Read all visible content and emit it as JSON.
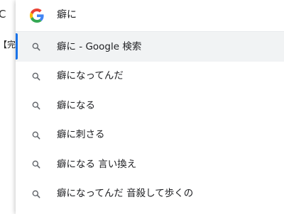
{
  "background_page": {
    "reload_glyph": "C",
    "text_fragment": "【完全"
  },
  "omnibox": {
    "engine_icon": "google-g-logo",
    "query": "癖に"
  },
  "suggestions": [
    {
      "label": "癖に - Google 検索",
      "icon": "search-icon",
      "selected": true
    },
    {
      "label": "癖になってんだ",
      "icon": "search-icon",
      "selected": false
    },
    {
      "label": "癖になる",
      "icon": "search-icon",
      "selected": false
    },
    {
      "label": "癖に刺さる",
      "icon": "search-icon",
      "selected": false
    },
    {
      "label": "癖になる 言い換え",
      "icon": "search-icon",
      "selected": false
    },
    {
      "label": "癖になってんだ 音殺して歩くの",
      "icon": "search-icon",
      "selected": false
    }
  ],
  "colors": {
    "accent": "#1a73e8",
    "selected_row": "#f1f3f4",
    "text": "#202124",
    "icon": "#5f6368"
  }
}
